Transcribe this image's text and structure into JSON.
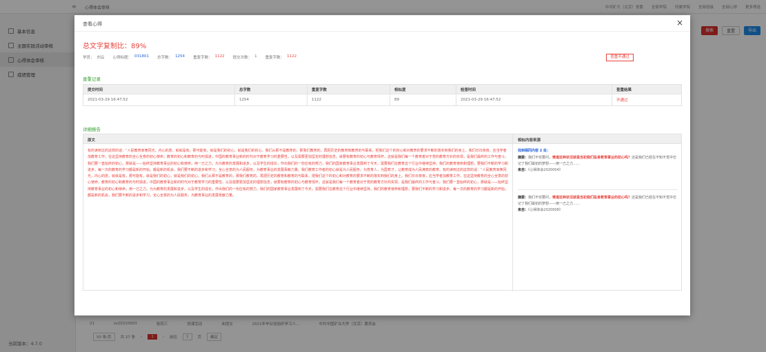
{
  "topbar": {
    "crumb": "心得体会审核",
    "right_items": [
      "中共矿大（北京）党委",
      "全部学院",
      "所属学院",
      "全部班级",
      "全部心得",
      "更多筛选"
    ]
  },
  "sidebar": {
    "items": [
      {
        "label": "基本信息"
      },
      {
        "label": "主题实践活动审核"
      },
      {
        "label": "心得体会审核"
      },
      {
        "label": "成绩管理"
      }
    ],
    "version": "当前版本：4.7.0"
  },
  "toolbar": {
    "search": "搜索",
    "reset": "重置",
    "export": "导出"
  },
  "bg_row": [
    "21",
    "zs20210003",
    "张同三",
    "党课活动",
    "未提交",
    "2021年毕业班组织学习人...",
    "中共中国矿业大学（北京）委员会"
  ],
  "pager": {
    "size": "50 条/页",
    "total": "共 27 条",
    "page": "1",
    "goto": "前往",
    "goto_page": "1",
    "unit": "页",
    "confirm": "确定"
  },
  "modal": {
    "title": "查看心得",
    "close": "×",
    "rate_label": "总文字复制比：89%",
    "info": {
      "student_label": "学员：",
      "student": "刘云",
      "id_label": "心得标题：",
      "id": "031801",
      "total_label": "总字数：",
      "total": "1254",
      "dup_label": "重复字数：",
      "dup": "1122",
      "count_label": "提交次数：",
      "count": "1",
      "dup2_label": "重复字数：",
      "dup2": "1122"
    },
    "status_button": "查重不通过",
    "check_title": "查重记录",
    "table": {
      "headers": [
        "提交时间",
        "总字数",
        "重复字数",
        "相似度",
        "检查时间",
        "查重结果"
      ],
      "row": [
        "2021-03-29 16:47:52",
        "1254",
        "1122",
        "89",
        "2021-03-29 16:47:52",
        "不通过"
      ]
    },
    "detail_title": "详细报告",
    "detail_head_left": "原文",
    "detail_head_right": "相似内容来源",
    "essay": "有的读到过的这样的话：“人民教育家黄冈光，内心的愿，就就是有，那可能有，就是我们的初心，就是我们的初心。我们从那不是教育的，那我们教育的。再把历史的教育和教育的与联系，把我们这个的初心和对教育的要求不断的落实到我们的身上。我们日日夜夜，应当学者加教育工作，在这坚持教育的全心全意的初心使命，教育的初心和教育的与时俱进，中国的教育事业新的时代对于教育学习的重要性，以及需要更加坚定的理想信念，就要有教育的初心与教育情怀，这就是我们每一个教育者对于党的教育方针的实现，是我们最终的工作与奋斗。我们要一直始终的初心，那就是——始终坚持教育事业的初心和使命，用一己之力，为为教育的发展和进步，以及学生的成长，作出我们的一份应有的努力，我们的国家教育事业发展到了今天，需要我们在教育这个行业中继续坚持，我们的教育使命和理想，要我们不断的学习和进步。每一次的教育的学习都是新的开始，都是新的机会，我们要不断的进步和学习，全心全意的为人民服务，为教育事业的发展贡献力量。我们教育工作者的初心就是为人民服务，为党育人，为国育才，让教育成为人民满意的教育。有的读到过的这样的话：“人民教育家黄冈光，内心的愿，就就是有，那可能有，就是我们的初心，就是我们的初心。我们从那不是教育的，那我们教育的。再把历史的教育和教育的与联系，把我们这个的初心和对教育的要求不断的落实到我们的身上。我们日日夜夜，应当学者加教育工作，在这坚持教育的全心全意的初心使命，教育的初心和教育的与时俱进，中国的教育事业新的时代对于教育学习的重要性，以及需要更加坚定的理想信念，就要有教育的初心与教育情怀，这就是我们每一个教育者对于党的教育方针的实现，是我们最终的工作与奋斗。我们要一直始终的初心，那就是——始终坚持教育事业的初心和使命，用一己之力，为为教育的发展和进步，以及学生的成长，作出我们的一份应有的努力，我们的国家教育事业发展到了今天，需要我们在教育这个行业中继续坚持，我们的教育使命和理想，要我们不断的学习和进步。每一次的教育的学习都是新的开始，都是新的机会，我们要不断的进步和学习，全心全意的为人民服务，为教育事业的发展贡献力量。",
    "sources": {
      "found": "找到相同内容 2 处：",
      "items": [
        {
          "excerpt_label": "摘要：",
          "pre": "我们不仅要问，",
          "highlight": "难道这种状况就是当初我们投身教育事业的初心吗？",
          "post": "还是我们已经在不知不觉中忘记了我们最初的梦想——用一己之力……",
          "source_label": "来自：",
          "source": "《心得体会2020004》"
        },
        {
          "excerpt_label": "摘要：",
          "pre": "我们不仅要问，",
          "highlight": "难道这种状况就是当初我们投身教育事业的初心吗？",
          "post": "还是我们已经在不知不觉中忘记了我们最初的梦想——用一己之力……",
          "source_label": "来自：",
          "source": "《心得体会2020008》"
        }
      ]
    }
  }
}
